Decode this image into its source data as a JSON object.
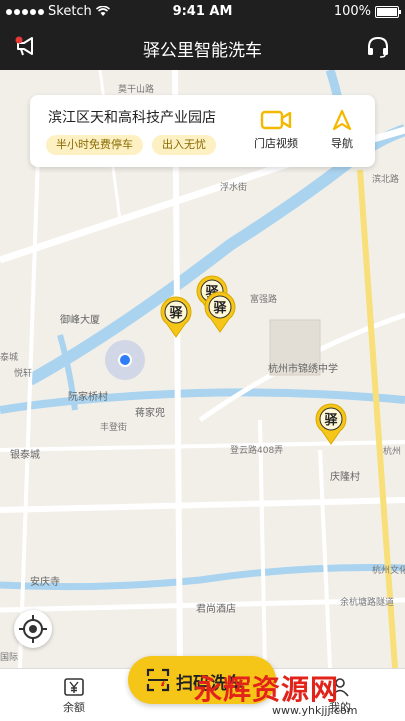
{
  "status_bar": {
    "carrier": "Sketch",
    "time": "9:41 AM",
    "battery": "100%"
  },
  "header": {
    "title": "驿公里智能洗车",
    "left_icon": "megaphone-icon",
    "right_icon": "headset-icon"
  },
  "store_card": {
    "name": "滨江区天和高科技产业园店",
    "tags": [
      "半小时免费停车",
      "出入无忧"
    ],
    "video_label": "门店视频",
    "nav_label": "导航"
  },
  "map_labels": {
    "road_top_right": "滨北路",
    "road_mid": "浮水街",
    "road_fuqiang": "富强路",
    "building_yuefeng": "御峰大厦",
    "school": "杭州市锦绣中学",
    "village_ruanjia": "阮家桥村",
    "village_jiangjia": "蒋家兜",
    "road_fengdeng": "丰登街",
    "road_dengyun": "登云路408弄",
    "village_qinglong": "庆隆村",
    "city_left": "银泰城",
    "temple": "安庆寺",
    "hotel": "君尚酒店",
    "tunnel": "余杭塘路隧道",
    "left_label": "悦轩",
    "left_label2": "泰城",
    "road_top": "莫干山路",
    "road_right": "杭州",
    "road_bottom_right": "杭州文化",
    "intl": "国际"
  },
  "pin_label": "驿",
  "tab_bar": {
    "balance": "余额",
    "scan": "扫码洗车",
    "mine": "我的"
  },
  "watermark": {
    "text": "永辉资源网",
    "url": "www.yhkjjj.com"
  },
  "colors": {
    "accent": "#f5c518",
    "header_bg": "#1f1f1f",
    "tag_bg": "#fdf1c4",
    "user_dot": "#2e7cf6"
  }
}
